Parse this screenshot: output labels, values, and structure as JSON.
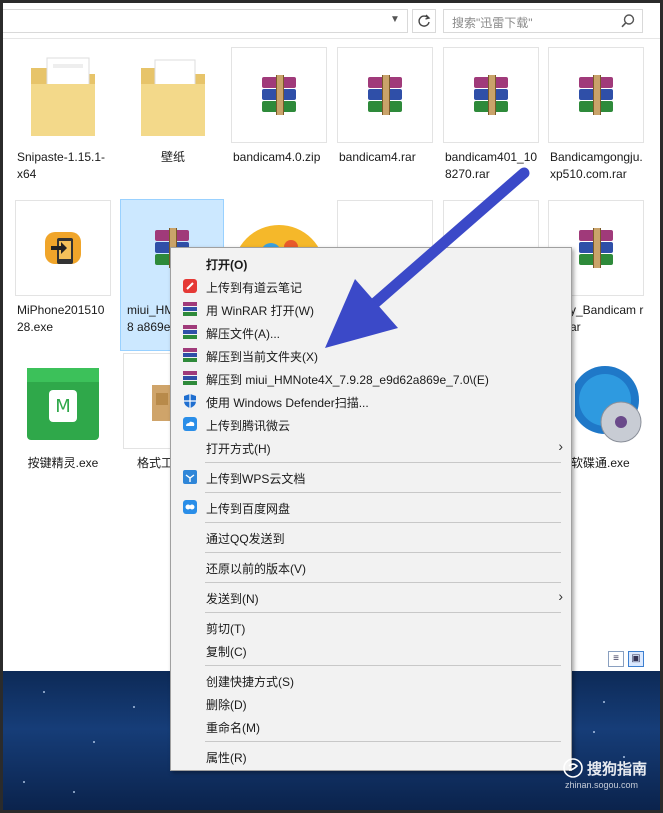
{
  "search": {
    "placeholder": "搜索\"迅雷下载\""
  },
  "files": [
    {
      "name": "Snipaste-1.15.1-x64",
      "icon": "folder-icon"
    },
    {
      "name": "壁纸",
      "icon": "folder-icon"
    },
    {
      "name": "bandicam4.0.zip",
      "icon": "winrar-archive-icon"
    },
    {
      "name": "bandicam4.rar",
      "icon": "winrar-archive-icon"
    },
    {
      "name": "bandicam401_108270.rar",
      "icon": "winrar-archive-icon"
    },
    {
      "name": "Bandicamgongju.xp510.com.rar",
      "icon": "winrar-archive-icon"
    },
    {
      "name": "MiPhone20151028.exe",
      "icon": "miphone-app-icon"
    },
    {
      "name": "miui_HMNote4X_7.9.28_e9d62a869e_7.0",
      "name_visible": "miui_HM X_7.9.28 a869e_",
      "icon": "winrar-archive-icon",
      "selected": true
    },
    {
      "name": "y_Bandicam rar",
      "icon": "winrar-archive-icon"
    },
    {
      "name": "按键精灵.exe",
      "icon": "anjian-app-icon"
    },
    {
      "name": "格式工",
      "icon": "installer-box-icon"
    },
    {
      "name": "软碟通.exe",
      "icon": "ultraiso-disc-icon"
    }
  ],
  "context_menu": {
    "items": [
      {
        "label": "打开(O)",
        "bold": true
      },
      {
        "label": "上传到有道云笔记",
        "icon": "youdao-note-icon"
      },
      {
        "label": "用 WinRAR 打开(W)",
        "icon": "winrar-icon"
      },
      {
        "label": "解压文件(A)...",
        "icon": "winrar-icon"
      },
      {
        "label": "解压到当前文件夹(X)",
        "icon": "winrar-icon"
      },
      {
        "label": "解压到 miui_HMNote4X_7.9.28_e9d62a869e_7.0\\(E)",
        "icon": "winrar-icon"
      },
      {
        "label": "使用 Windows Defender扫描...",
        "icon": "defender-shield-icon"
      },
      {
        "label": "上传到腾讯微云",
        "icon": "weiyun-cloud-icon"
      },
      {
        "label": "打开方式(H)",
        "submenu": true
      },
      {
        "label": "上传到WPS云文档",
        "icon": "wps-cloud-icon"
      },
      {
        "label": "上传到百度网盘",
        "icon": "baidu-netdisk-icon"
      },
      {
        "label": "通过QQ发送到"
      },
      {
        "label": "还原以前的版本(V)"
      },
      {
        "label": "发送到(N)",
        "submenu": true
      },
      {
        "label": "剪切(T)"
      },
      {
        "label": "复制(C)"
      },
      {
        "label": "创建快捷方式(S)"
      },
      {
        "label": "删除(D)"
      },
      {
        "label": "重命名(M)"
      },
      {
        "label": "属性(R)"
      }
    ]
  },
  "watermark": {
    "name": "搜狗指南",
    "url": "zhinan.sogou.com"
  },
  "colors": {
    "arrow": "#3b49c8",
    "selection": "#cce8ff",
    "menu_bg": "#f2f2f2"
  }
}
